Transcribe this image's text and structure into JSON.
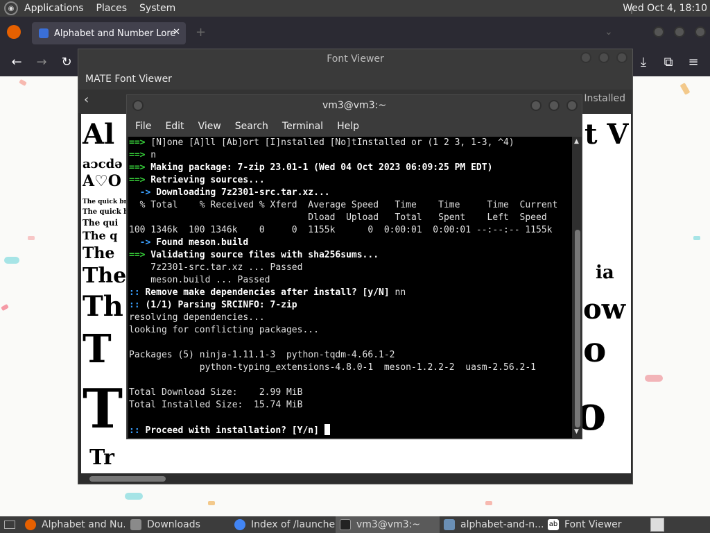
{
  "top_panel": {
    "menus": [
      "Applications",
      "Places",
      "System"
    ],
    "clock": "Wed Oct  4, 18:10"
  },
  "firefox": {
    "tab_title": "Alphabet and Number Lore",
    "tab_close": "✕",
    "new_tab": "+",
    "nav": {
      "back": "←",
      "forward": "→",
      "reload": "↻",
      "downloads": "⤓",
      "extensions": "⧉",
      "menu": "≡"
    }
  },
  "font_viewer": {
    "window_title": "Font Viewer",
    "header": "MATE Font Viewer",
    "back": "‹",
    "installed": "Installed"
  },
  "terminal": {
    "title": "vm3@vm3:~",
    "menu": [
      "File",
      "Edit",
      "View",
      "Search",
      "Terminal",
      "Help"
    ],
    "lines": [
      "==> [N]one [A]ll [Ab]ort [I]nstalled [No]tInstalled or (1 2 3, 1-3, ^4)",
      "==> n",
      "==> Making package: 7-zip 23.01-1 (Wed 04 Oct 2023 06:09:25 PM EDT)",
      "==> Retrieving sources...",
      "  -> Downloading 7z2301-src.tar.xz...",
      "  % Total    % Received % Xferd  Average Speed   Time    Time     Time  Current",
      "                                 Dload  Upload   Total   Spent    Left  Speed",
      "100 1346k  100 1346k    0     0  1155k      0  0:00:01  0:00:01 --:--:-- 1155k",
      "  -> Found meson.build",
      "==> Validating source files with sha256sums...",
      "    7z2301-src.tar.xz ... Passed",
      "    meson.build ... Passed",
      ":: Remove make dependencies after install? [y/N] nn",
      ":: (1/1) Parsing SRCINFO: 7-zip",
      "resolving dependencies...",
      "looking for conflicting packages...",
      "",
      "Packages (5) ninja-1.11.1-3  python-tqdm-4.66.1-2",
      "             python-typing_extensions-4.8.0-1  meson-1.2.2-2  uasm-2.56.2-1",
      "",
      "Total Download Size:    2.99 MiB",
      "Total Installed Size:  15.74 MiB",
      "",
      ":: Proceed with installation? [Y/n] "
    ]
  },
  "taskbar": {
    "items": [
      {
        "label": "Alphabet and Nu...",
        "icon": "firefox-icon",
        "color": "#e66000"
      },
      {
        "label": "Downloads",
        "icon": "folder-icon",
        "color": "#8a8a8a"
      },
      {
        "label": "Index of /launche...",
        "icon": "chrome-icon",
        "color": "#4285f4"
      },
      {
        "label": "vm3@vm3:~",
        "icon": "terminal-icon",
        "color": "#222222"
      },
      {
        "label": "alphabet-and-n...",
        "icon": "image-viewer-icon",
        "color": "#6a8fb5"
      },
      {
        "label": "Font Viewer",
        "icon": "font-viewer-icon",
        "color": "#ffffff"
      }
    ]
  },
  "colors": {
    "prompt_green": "#37d03a",
    "prompt_blue": "#3aa0ff",
    "panel": "#3c3c3c"
  }
}
